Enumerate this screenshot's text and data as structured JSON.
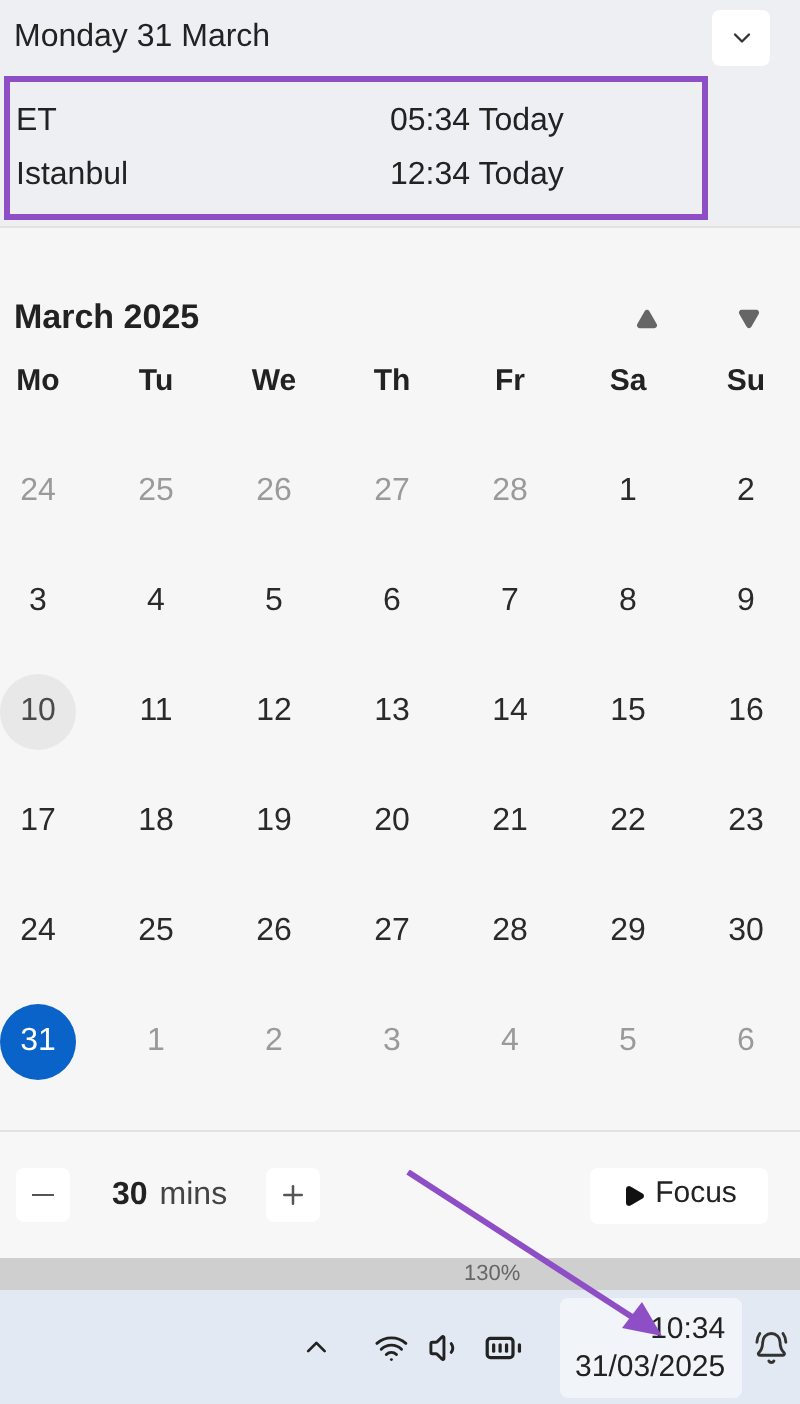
{
  "header": {
    "date": "Monday 31 March",
    "collapse_expanded": true
  },
  "clocks": [
    {
      "name": "ET",
      "time": "05:34 Today"
    },
    {
      "name": "Istanbul",
      "time": "12:34 Today"
    }
  ],
  "calendar": {
    "month": "March 2025",
    "weekdays": [
      "Mo",
      "Tu",
      "We",
      "Th",
      "Fr",
      "Sa",
      "Su"
    ],
    "days": [
      {
        "label": "24",
        "in_month": false,
        "selected": false,
        "hovered": false
      },
      {
        "label": "25",
        "in_month": false,
        "selected": false,
        "hovered": false
      },
      {
        "label": "26",
        "in_month": false,
        "selected": false,
        "hovered": false
      },
      {
        "label": "27",
        "in_month": false,
        "selected": false,
        "hovered": false
      },
      {
        "label": "28",
        "in_month": false,
        "selected": false,
        "hovered": false
      },
      {
        "label": "1",
        "in_month": true,
        "selected": false,
        "hovered": false
      },
      {
        "label": "2",
        "in_month": true,
        "selected": false,
        "hovered": false
      },
      {
        "label": "3",
        "in_month": true,
        "selected": false,
        "hovered": false
      },
      {
        "label": "4",
        "in_month": true,
        "selected": false,
        "hovered": false
      },
      {
        "label": "5",
        "in_month": true,
        "selected": false,
        "hovered": false
      },
      {
        "label": "6",
        "in_month": true,
        "selected": false,
        "hovered": false
      },
      {
        "label": "7",
        "in_month": true,
        "selected": false,
        "hovered": false
      },
      {
        "label": "8",
        "in_month": true,
        "selected": false,
        "hovered": false
      },
      {
        "label": "9",
        "in_month": true,
        "selected": false,
        "hovered": false
      },
      {
        "label": "10",
        "in_month": true,
        "selected": false,
        "hovered": true
      },
      {
        "label": "11",
        "in_month": true,
        "selected": false,
        "hovered": false
      },
      {
        "label": "12",
        "in_month": true,
        "selected": false,
        "hovered": false
      },
      {
        "label": "13",
        "in_month": true,
        "selected": false,
        "hovered": false
      },
      {
        "label": "14",
        "in_month": true,
        "selected": false,
        "hovered": false
      },
      {
        "label": "15",
        "in_month": true,
        "selected": false,
        "hovered": false
      },
      {
        "label": "16",
        "in_month": true,
        "selected": false,
        "hovered": false
      },
      {
        "label": "17",
        "in_month": true,
        "selected": false,
        "hovered": false
      },
      {
        "label": "18",
        "in_month": true,
        "selected": false,
        "hovered": false
      },
      {
        "label": "19",
        "in_month": true,
        "selected": false,
        "hovered": false
      },
      {
        "label": "20",
        "in_month": true,
        "selected": false,
        "hovered": false
      },
      {
        "label": "21",
        "in_month": true,
        "selected": false,
        "hovered": false
      },
      {
        "label": "22",
        "in_month": true,
        "selected": false,
        "hovered": false
      },
      {
        "label": "23",
        "in_month": true,
        "selected": false,
        "hovered": false
      },
      {
        "label": "24",
        "in_month": true,
        "selected": false,
        "hovered": false
      },
      {
        "label": "25",
        "in_month": true,
        "selected": false,
        "hovered": false
      },
      {
        "label": "26",
        "in_month": true,
        "selected": false,
        "hovered": false
      },
      {
        "label": "27",
        "in_month": true,
        "selected": false,
        "hovered": false
      },
      {
        "label": "28",
        "in_month": true,
        "selected": false,
        "hovered": false
      },
      {
        "label": "29",
        "in_month": true,
        "selected": false,
        "hovered": false
      },
      {
        "label": "30",
        "in_month": true,
        "selected": false,
        "hovered": false
      },
      {
        "label": "31",
        "in_month": true,
        "selected": true,
        "hovered": false
      },
      {
        "label": "1",
        "in_month": false,
        "selected": false,
        "hovered": false
      },
      {
        "label": "2",
        "in_month": false,
        "selected": false,
        "hovered": false
      },
      {
        "label": "3",
        "in_month": false,
        "selected": false,
        "hovered": false
      },
      {
        "label": "4",
        "in_month": false,
        "selected": false,
        "hovered": false
      },
      {
        "label": "5",
        "in_month": false,
        "selected": false,
        "hovered": false
      },
      {
        "label": "6",
        "in_month": false,
        "selected": false,
        "hovered": false
      }
    ]
  },
  "focus": {
    "duration": "30",
    "unit": "mins",
    "button": "Focus"
  },
  "document_status": {
    "zoom": "130%"
  },
  "taskbar": {
    "time": "10:34",
    "date": "31/03/2025"
  }
}
